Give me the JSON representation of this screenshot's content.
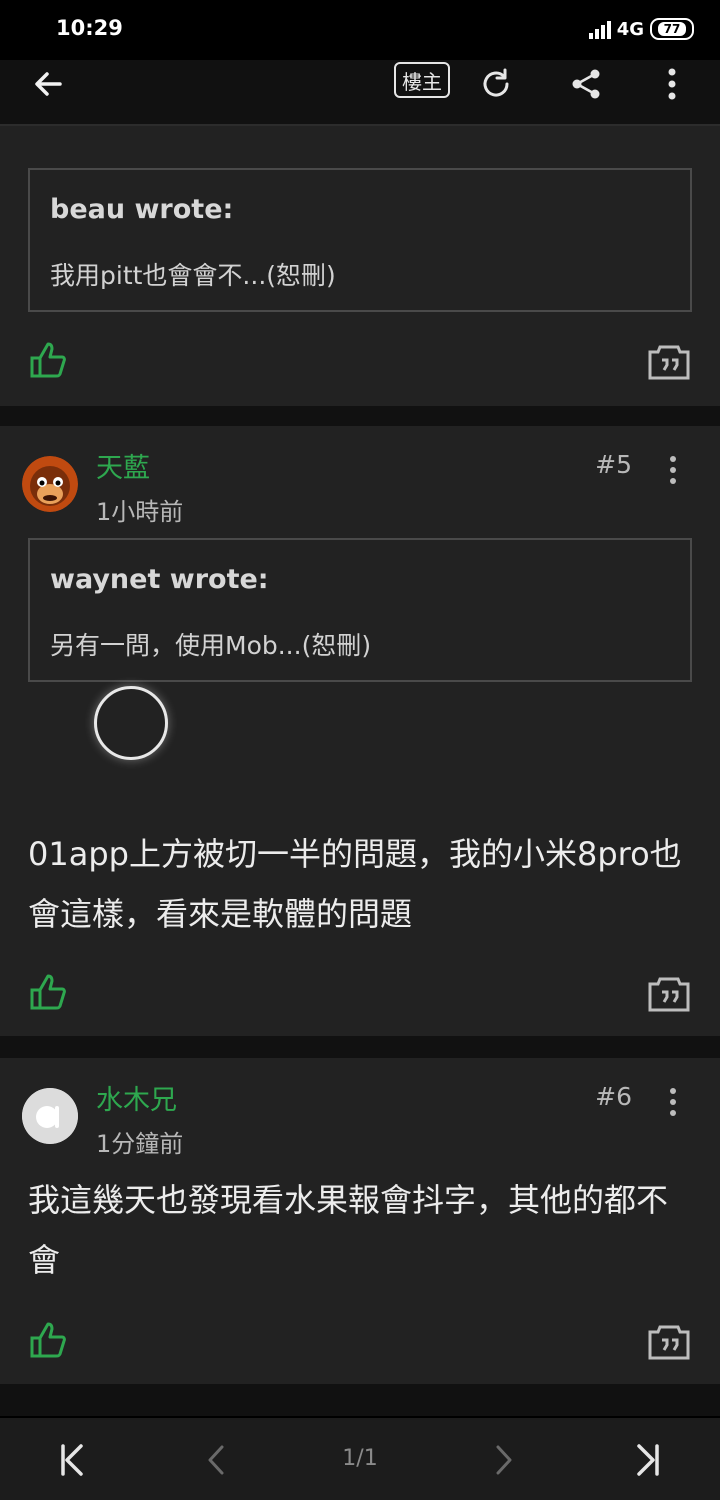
{
  "status": {
    "time": "10:29",
    "network": "4G",
    "battery": "77"
  },
  "toolbar": {
    "louzhu_label": "樓主"
  },
  "posts": [
    {
      "quote_author": "beau wrote:",
      "quote_text": "我用pitt也會會不...(恕刪)"
    },
    {
      "username": "天藍",
      "time": "1小時前",
      "floor": "#5",
      "quote_author": "waynet wrote:",
      "quote_text": "另有一問，使用Mob...(恕刪)",
      "text": "01app上方被切一半的問題，我的小米8pro也會這樣，看來是軟體的問題"
    },
    {
      "username": "水木兄",
      "time": "1分鐘前",
      "floor": "#6",
      "text": "我這幾天也發現看水果報會抖字，其他的都不會"
    }
  ],
  "pagination": {
    "indicator": "1/1"
  },
  "colors": {
    "accent": "#2ea84f",
    "card": "#222222",
    "background": "#111111"
  }
}
